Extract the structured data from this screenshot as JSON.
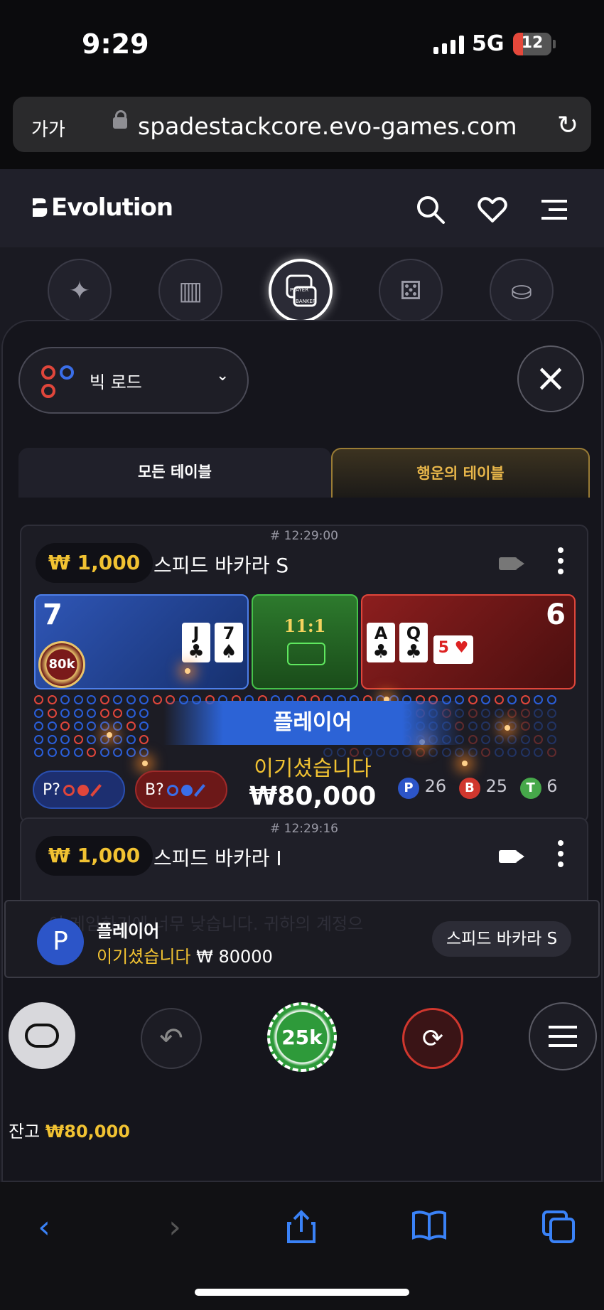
{
  "status_bar": {
    "time": "9:29",
    "network": "5G",
    "battery": "12"
  },
  "browser": {
    "text_size_label": "가가",
    "url": "spadestackcore.evo-games.com",
    "toolbar_icons": [
      "back-icon",
      "forward-icon",
      "share-icon",
      "bookmarks-icon",
      "tabs-icon"
    ]
  },
  "header": {
    "logo": "Evolution",
    "icons": [
      "search-icon",
      "heart-icon",
      "menu-icon"
    ]
  },
  "categories": [
    "sparkles-icon",
    "podium-icon",
    "baccarat-icon",
    "dice-icon",
    "roulette-icon"
  ],
  "road_selector": {
    "label": "빅 로드"
  },
  "tabs": {
    "all": "모든 테이블",
    "lucky": "행운의 테이블"
  },
  "table1": {
    "timestamp": "# 12:29:00",
    "bet": "₩ 1,000",
    "name": "스피드 바카라 S",
    "player_score": "7",
    "banker_score": "6",
    "tie_odds": "11:1",
    "chip": "80k",
    "player_cards": [
      {
        "rank": "J",
        "suit": "♣"
      },
      {
        "rank": "7",
        "suit": "♠"
      }
    ],
    "banker_cards": [
      {
        "rank": "A",
        "suit": "♣"
      },
      {
        "rank": "Q",
        "suit": "♣"
      },
      {
        "rank": "5",
        "suit": "♥"
      }
    ],
    "win_label": "플레이어",
    "win_text": "이기셨습니다",
    "win_amount": "₩80,000",
    "predict_p": "P?",
    "predict_b": "B?",
    "stats": {
      "p_label": "P",
      "p_count": "26",
      "b_label": "B",
      "b_count": "25",
      "t_label": "T",
      "t_count": "6"
    }
  },
  "table2": {
    "timestamp": "# 12:29:16",
    "bet": "₩ 1,000",
    "name": "스피드 바카라 I"
  },
  "notification": {
    "avatar": "P",
    "title": "플레이어",
    "win_text": "이기셨습니다",
    "amount": "₩ 80000",
    "table": "스피드 바카라 S",
    "ghost_text": "이 게임하기에 너무 낮습니다. 귀하의 계정으"
  },
  "controls": {
    "chip_value": "25k"
  },
  "balance": {
    "label": "잔고",
    "value": "₩80,000"
  },
  "colors": {
    "player": "#2c55c8",
    "banker": "#d0372e",
    "tie": "#46c24a",
    "gold": "#f1c232"
  }
}
